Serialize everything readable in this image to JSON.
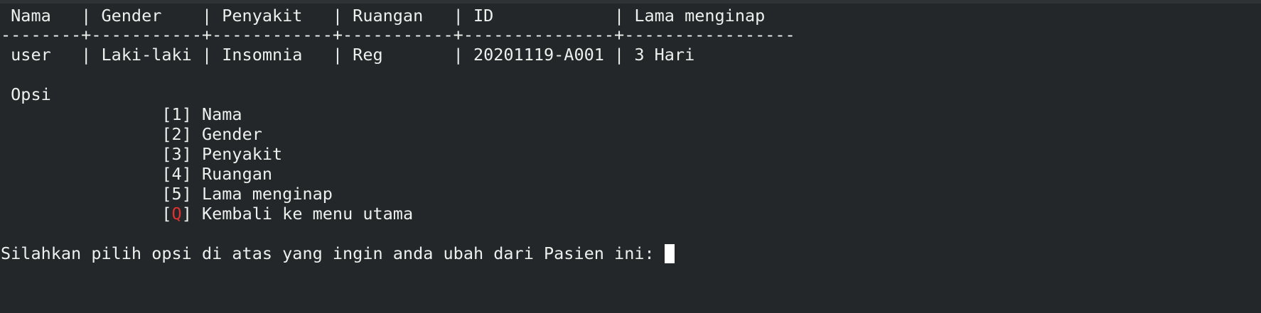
{
  "table": {
    "header": " Nama   | Gender    | Penyakit   | Ruangan   | ID            | Lama menginap",
    "separator": "--------+-----------+------------+-----------+---------------+-----------------",
    "row": " user   | Laki-laki | Insomnia   | Reg       | 20201119-A001 | 3 Hari"
  },
  "menu": {
    "title": " Opsi",
    "indent": "                ",
    "options": [
      {
        "key": "1",
        "label": " Nama"
      },
      {
        "key": "2",
        "label": " Gender"
      },
      {
        "key": "3",
        "label": " Penyakit"
      },
      {
        "key": "4",
        "label": " Ruangan"
      },
      {
        "key": "5",
        "label": " Lama menginap"
      },
      {
        "key": "Q",
        "label": " Kembali ke menu utama"
      }
    ]
  },
  "prompt": "Silahkan pilih opsi di atas yang ingin anda ubah dari Pasien ini: ",
  "colors": {
    "background": "#232729",
    "text": "#eef0ee",
    "quit_key": "#e03131",
    "cursor": "#ffffff"
  }
}
